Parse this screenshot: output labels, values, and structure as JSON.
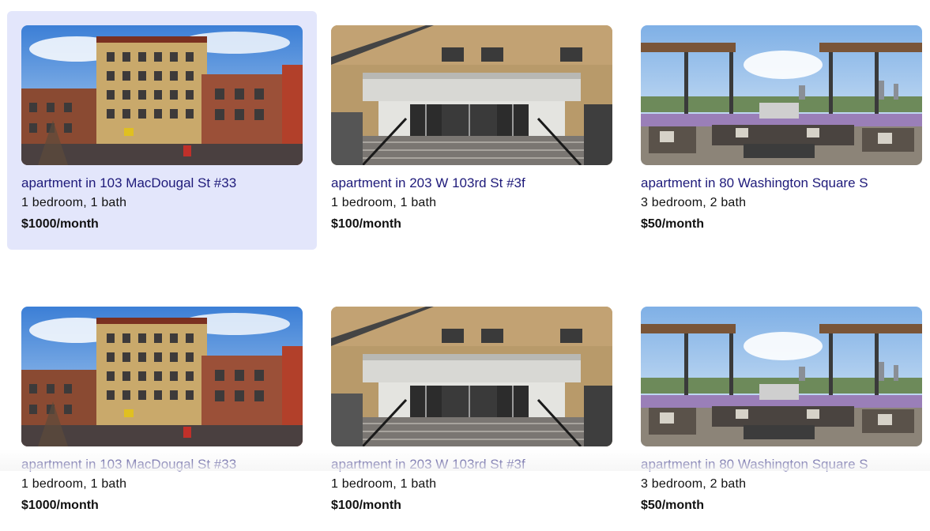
{
  "listings": [
    {
      "title": "apartment in 103 MacDougal St #33",
      "details": "1 bedroom, 1 bath",
      "price": "$1000/month",
      "photo": "brick-apartment-building"
    },
    {
      "title": "apartment in 203 W 103rd St #3f",
      "details": "1 bedroom, 1 bath",
      "price": "$100/month",
      "photo": "building-entrance-stairs"
    },
    {
      "title": "apartment in 80 Washington Square S",
      "details": "3 bedroom, 2 bath",
      "price": "$50/month",
      "photo": "rooftop-terrace"
    },
    {
      "title": "apartment in 103 MacDougal St #33",
      "details": "1 bedroom, 1 bath",
      "price": "$1000/month",
      "photo": "brick-apartment-building"
    },
    {
      "title": "apartment in 203 W 103rd St #3f",
      "details": "1 bedroom, 1 bath",
      "price": "$100/month",
      "photo": "building-entrance-stairs"
    },
    {
      "title": "apartment in 80 Washington Square S",
      "details": "3 bedroom, 2 bath",
      "price": "$50/month",
      "photo": "rooftop-terrace"
    }
  ],
  "colors": {
    "hover_card": "#e3e6fb",
    "title_link": "#1e1a7a",
    "text": "#111111"
  }
}
